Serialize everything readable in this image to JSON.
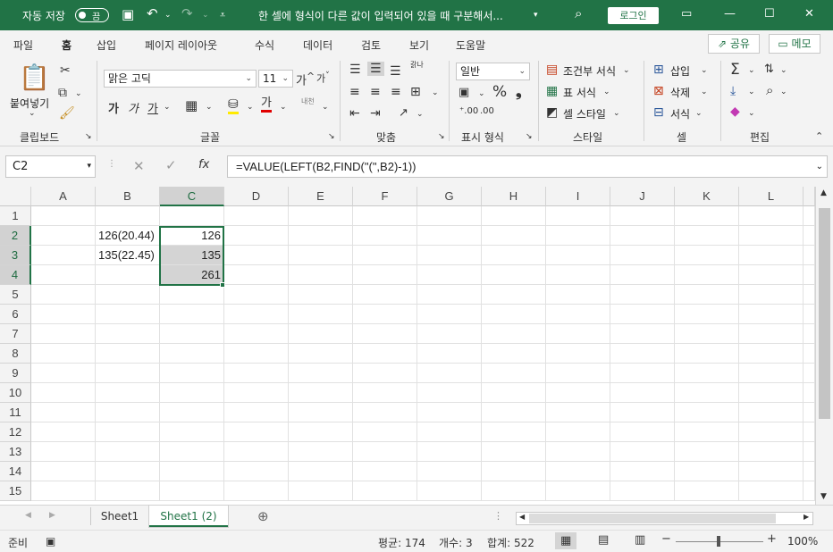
{
  "title_bar": {
    "autosave_label": "자동 저장",
    "autosave_state": "끔",
    "document_title": "한 셀에 형식이 다른 값이 입력되어 있을 때 구분해서...",
    "login_label": "로그인"
  },
  "menu_tabs": [
    "파일",
    "홈",
    "삽입",
    "페이지 레이아웃",
    "수식",
    "데이터",
    "검토",
    "보기",
    "도움말"
  ],
  "active_tab": "홈",
  "share_label": "공유",
  "memo_label": "메모",
  "ribbon": {
    "clipboard": {
      "paste_label": "붙여넣기",
      "group_label": "클립보드"
    },
    "font": {
      "font_name": "맑은 고딕",
      "font_size": "11",
      "group_label": "글꼴",
      "bold": "가",
      "italic": "가",
      "underline": "가",
      "font_color_glyph": "가",
      "phonetic": "내천"
    },
    "alignment": {
      "group_label": "맞춤",
      "wrap_glyph": "갉나"
    },
    "number": {
      "format": "일반",
      "group_label": "표시 형식"
    },
    "styles": {
      "conditional": "조건부 서식",
      "table": "표 서식",
      "cell_style": "셀 스타일",
      "group_label": "스타일"
    },
    "cells": {
      "insert": "삽입",
      "delete": "삭제",
      "format": "서식",
      "group_label": "셀"
    },
    "editing": {
      "group_label": "편집"
    }
  },
  "formula_bar": {
    "name_box": "C2",
    "formula": "=VALUE(LEFT(B2,FIND(\"(\",B2)-1))"
  },
  "grid": {
    "columns": [
      "A",
      "B",
      "C",
      "D",
      "E",
      "F",
      "G",
      "H",
      "I",
      "J",
      "K",
      "L"
    ],
    "rows": [
      "1",
      "2",
      "3",
      "4",
      "5",
      "6",
      "7",
      "8",
      "9",
      "10",
      "11",
      "12",
      "13",
      "14",
      "15"
    ],
    "selected_column": "C",
    "cells": {
      "B2": "126(20.44)",
      "C2": "126",
      "B3": "135(22.45)",
      "C3": "135",
      "C4": "261"
    }
  },
  "sheets": [
    "Sheet1",
    "Sheet1 (2)"
  ],
  "active_sheet": "Sheet1 (2)",
  "status_bar": {
    "ready": "준비",
    "average": "평균: 174",
    "count": "개수: 3",
    "sum": "합계: 522",
    "zoom": "100%"
  }
}
